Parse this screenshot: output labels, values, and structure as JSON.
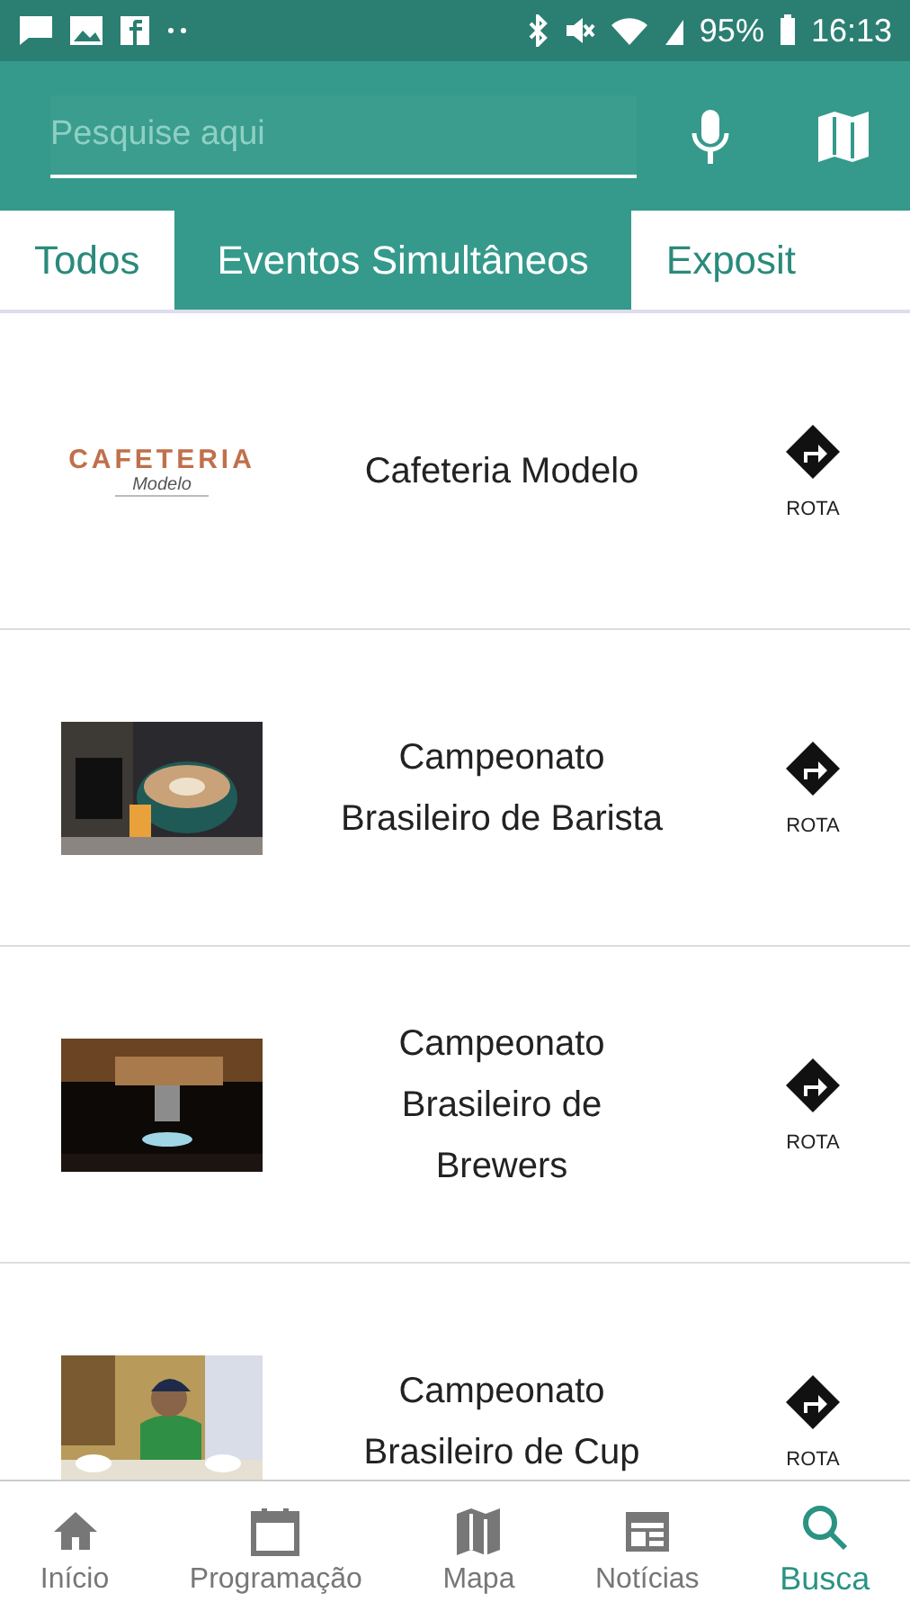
{
  "status_bar": {
    "battery": "95%",
    "time": "16:13"
  },
  "search": {
    "placeholder": "Pesquise aqui"
  },
  "tabs": [
    {
      "label": "Todos",
      "selected": false
    },
    {
      "label": "Eventos Simultâneos",
      "selected": true
    },
    {
      "label": "Exposit",
      "selected": false
    }
  ],
  "items": [
    {
      "kind": "logo",
      "logo_word": "CAFETERIA",
      "logo_script": "Modelo",
      "title": "Cafeteria Modelo",
      "action": "ROTA"
    },
    {
      "kind": "picture",
      "title": "Campeonato Brasileiro de Barista",
      "action": "ROTA"
    },
    {
      "kind": "picture",
      "title": "Campeonato Brasileiro de Brewers",
      "action": "ROTA"
    },
    {
      "kind": "picture",
      "title": "Campeonato Brasileiro de Cup",
      "action": "ROTA"
    }
  ],
  "nav": [
    {
      "label": "Início",
      "selected": false
    },
    {
      "label": "Programação",
      "selected": false
    },
    {
      "label": "Mapa",
      "selected": false
    },
    {
      "label": "Notícias",
      "selected": false
    },
    {
      "label": "Busca",
      "selected": true
    }
  ]
}
